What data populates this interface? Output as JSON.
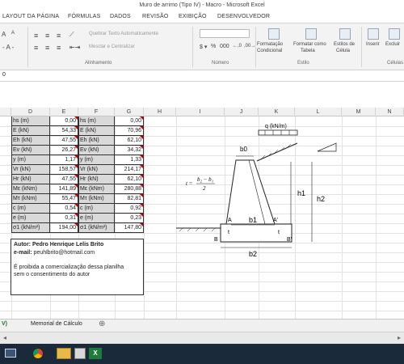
{
  "window_title": "Muro de arrimo (Tipo IV) - Macro - Microsoft Excel",
  "ribbon_tabs": [
    "LAYOUT DA PÁGINA",
    "FÓRMULAS",
    "DADOS",
    "REVISÃO",
    "EXIBIÇÃO",
    "DESENVOLVEDOR"
  ],
  "ribbon": {
    "wrap_text": "Quebrar Texto Automaticamente",
    "merge_center": "Mesclar e Centralizar",
    "alignment_label": "Alinhamento",
    "number_format": "%",
    "number_format_000": "000",
    "number_label": "Número",
    "cond_format_1": "Formatação",
    "cond_format_2": "Condicional",
    "format_table_1": "Formatar como",
    "format_table_2": "Tabela",
    "cell_styles_1": "Estilos de",
    "cell_styles_2": "Célula",
    "style_label": "Estilo",
    "insert": "Inserir",
    "delete": "Excluir",
    "cells_label": "Células",
    "font_a": "A",
    "font_a2": "A"
  },
  "formula_bar": {
    "value": "0"
  },
  "columns": [
    "D",
    "E",
    "F",
    "G",
    "H",
    "I",
    "J",
    "K",
    "L",
    "M",
    "N"
  ],
  "table": {
    "rows": [
      {
        "l1": "hs (m)",
        "v1": "0,00",
        "l2": "hs (m)",
        "v2": "0,00"
      },
      {
        "l1": "E (kN)",
        "v1": "54,33",
        "l2": "E (kN)",
        "v2": "70,96"
      },
      {
        "l1": "Eh (kN)",
        "v1": "47,55",
        "l2": "Eh (kN)",
        "v2": "62,10"
      },
      {
        "l1": "Ev (kN)",
        "v1": "26,27",
        "l2": "Ev (kN)",
        "v2": "34,32"
      },
      {
        "l1": "y (m)",
        "v1": "1,17",
        "l2": "y (m)",
        "v2": "1,33"
      },
      {
        "l1": "Vr (kN)",
        "v1": "158,57",
        "l2": "Vr (kN)",
        "v2": "214,17"
      },
      {
        "l1": "Hr (kN)",
        "v1": "47,55",
        "l2": "Hr (kN)",
        "v2": "62,10"
      },
      {
        "l1": "Mε (kNm)",
        "v1": "141,89",
        "l2": "Mε (kNm)",
        "v2": "280,88"
      },
      {
        "l1": "Mτ (kNm)",
        "v1": "55,47",
        "l2": "Mτ (kNm)",
        "v2": "82,81"
      },
      {
        "l1": "c (m)",
        "v1": "0,54",
        "l2": "c (m)",
        "v2": "0,92"
      },
      {
        "l1": "e (m)",
        "v1": "0,31",
        "l2": "e (m)",
        "v2": "0,23"
      },
      {
        "l1": "σ1 (kN/m²)",
        "v1": "194,00",
        "l2": "σ1 (kN/m²)",
        "v2": "147,80"
      }
    ]
  },
  "author": {
    "line1": "Autor: Pedro Henrique Lelis Brito",
    "line2": "e-mail: peuhlbrito@hotmail.com",
    "line3": "É proibida a comercialização dessa planilha",
    "line4": "sem o consentimento do autor"
  },
  "diagram": {
    "q_label": "q (kN/m)",
    "b0": "b0",
    "alpha": "α",
    "t_formula_left": "t =",
    "t_formula_num": "b₂ − b₁",
    "t_formula_den": "2",
    "h1": "h1",
    "h2": "h2",
    "A": "A",
    "A2": "A'",
    "b1": "b1",
    "t1": "t",
    "t2": "t",
    "B": "B",
    "B2": "B'",
    "b2": "b2"
  },
  "sheet_tabs": {
    "first": "V)",
    "second": "Memorial de Cálculo",
    "add": "⊕"
  },
  "taskbar_icons": [
    "screen-icon",
    "chrome-icon",
    "explorer-icon",
    "files-icon",
    "excel-icon"
  ]
}
